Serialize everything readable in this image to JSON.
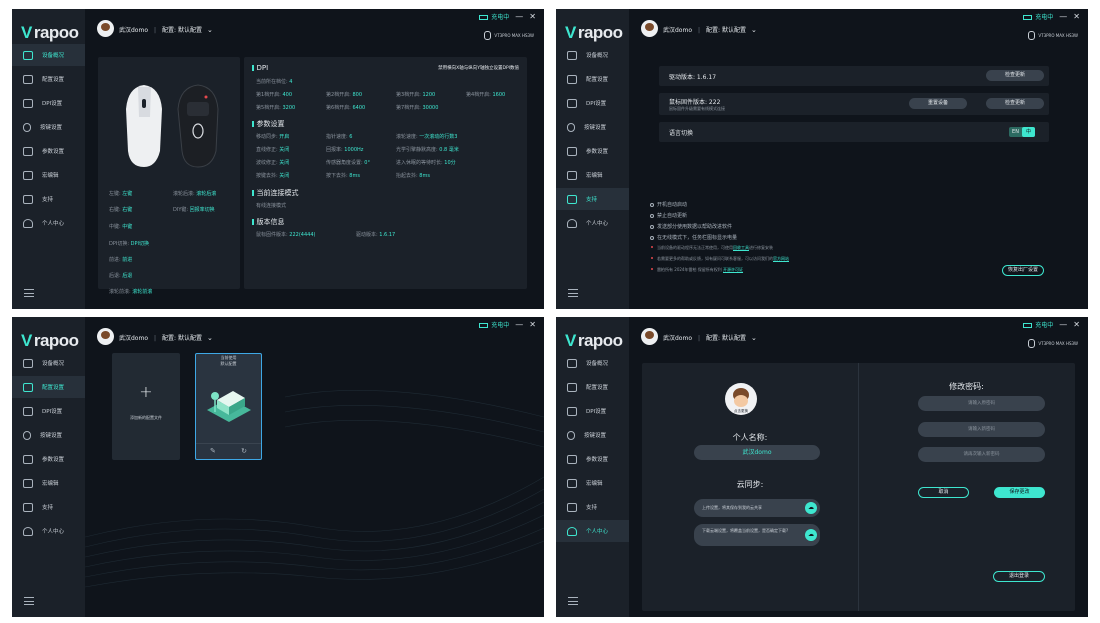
{
  "common": {
    "logo_mark": "V",
    "logo_text": "rapoo",
    "user_name": "武汉domo",
    "config_label": "配置: 默认配置",
    "charging": "充电中",
    "minimize": "—",
    "close": "✕",
    "device_name": "VT3PRO MAX HS3W",
    "nav": [
      "设备概况",
      "配置设置",
      "DPI设置",
      "按键设置",
      "参数设置",
      "宏编辑",
      "支持",
      "个人中心"
    ]
  },
  "screens": {
    "overview": {
      "buttons": [
        {
          "label": "左键:",
          "value": "左键"
        },
        {
          "label": "右键:",
          "value": "右键"
        },
        {
          "label": "中键:",
          "value": "中键"
        },
        {
          "label": "DPI切换:",
          "value": "DPI切换"
        },
        {
          "label": "前进:",
          "value": "前进"
        },
        {
          "label": "后退:",
          "value": "后退"
        },
        {
          "label": "滚轮前滚:",
          "value": "滚轮前滚"
        }
      ],
      "buttons_right": [
        {
          "label": "滚轮后滚:",
          "value": "滚轮后滚"
        },
        {
          "label": "DIY键:",
          "value": "回报率切换"
        }
      ],
      "dpi_title": "DPI",
      "dpi_hint": "禁用横向X轴与纵向Y轴独立设置DPI数值",
      "dpi_current_label": "当前所在档位:",
      "dpi_current": "4",
      "dpi_levels": [
        {
          "label": "第1档开启:",
          "value": "400"
        },
        {
          "label": "第2档开启:",
          "value": "800"
        },
        {
          "label": "第3档开启:",
          "value": "1200"
        },
        {
          "label": "第4档开启:",
          "value": "1600"
        },
        {
          "label": "第5档开启:",
          "value": "3200"
        },
        {
          "label": "第6档开启:",
          "value": "6400"
        },
        {
          "label": "第7档开启:",
          "value": "30000"
        }
      ],
      "params_title": "参数设置",
      "params": [
        {
          "label": "移动同步:",
          "value": "开启"
        },
        {
          "label": "指针速度:",
          "value": "6"
        },
        {
          "label": "滚轮速度:",
          "value": "一次滚动的行数3"
        },
        {
          "label": "直线修正:",
          "value": "关闭"
        },
        {
          "label": "回报率:",
          "value": "1000Hz"
        },
        {
          "label": "光学引擎静默高度:",
          "value": "0.8 毫米"
        },
        {
          "label": "波纹修正:",
          "value": "关闭"
        },
        {
          "label": "传感器角度设置:",
          "value": "0°"
        },
        {
          "label": "进入休眠的等待时长:",
          "value": "10分"
        },
        {
          "label": "按键去抖:",
          "value": "关闭"
        },
        {
          "label": "按下去抖:",
          "value": "8ms"
        },
        {
          "label": "抬起去抖:",
          "value": "8ms"
        }
      ],
      "mode_title": "当前连接模式",
      "mode_value": "有线连接模式",
      "version_title": "版本信息",
      "firmware_label": "鼠标固件版本:",
      "firmware_value": "222(4444)",
      "driver_label": "驱动版本:",
      "driver_value": "1.6.17"
    },
    "support": {
      "driver_version": "驱动版本: 1.6.17",
      "check_update": "检查更新",
      "firmware_version": "鼠标固件版本: 222",
      "firmware_note": "鼠标固件升级需要有线模式连接",
      "reset_device": "重置设备",
      "check_update2": "检查更新",
      "language_label": "语言切换",
      "lang_en": "EN",
      "lang_cn": "中",
      "options": [
        "开机自动启动",
        "禁止自动更新",
        "发送部分使用数据以帮助改进软件",
        "在无线模式下，任务栏图标显示电量"
      ],
      "notice1_pre": "当前设备的驱动程序无法正常使用，可使用",
      "notice1_link": "回收工具",
      "notice1_post": "进行修复安装",
      "notice2_pre": "若需要更多的帮助或反馈，如有疑问可联系客服，可以访问我们的",
      "notice2_link": "官方网站",
      "notice3_pre": "雷柏所有 2024年雷柏 保留所有权利",
      "notice3_link": "开源许可证",
      "factory_reset": "恢复出厂设置"
    },
    "config": {
      "add_config": "添加新的配置文件",
      "current_use": "当前使用",
      "default_config": "默认配置"
    },
    "personal": {
      "avatar_caption": "点击更换",
      "name_title": "个人名称:",
      "name_value": "武汉domo",
      "cloud_title": "云同步:",
      "upload_text": "上传设置，将其保存到我的云共享",
      "download_text": "下载云端设置，将覆盖当前设置，是否确定下载?",
      "pw_title": "修改密码:",
      "pw_old": "请输入原密码",
      "pw_new": "请输入新密码",
      "pw_confirm": "请再次输入新密码",
      "cancel": "取消",
      "save": "保存更改",
      "logout": "退出登录"
    }
  }
}
